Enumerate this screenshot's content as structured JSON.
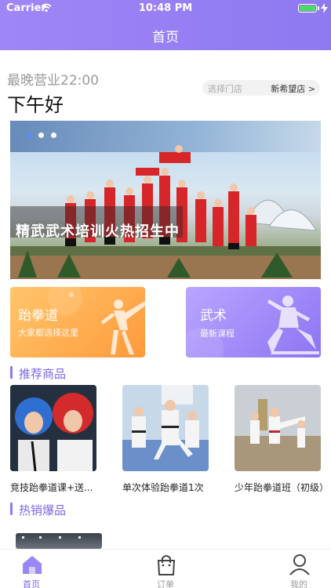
{
  "status_bar": {
    "carrier": "Carrier",
    "time": "10:48 PM"
  },
  "nav": {
    "title": "首页"
  },
  "greeting": {
    "hours": "最晚营业22:00",
    "text": "下午好"
  },
  "store": {
    "hint": "选择门店",
    "name": "新希望店 >"
  },
  "banner": {
    "caption": "精武武术培训火热招生中",
    "page_count": 3,
    "active_page": 1
  },
  "categories": [
    {
      "title": "跆拳道",
      "subtitle": "大家都选择这里"
    },
    {
      "title": "武术",
      "subtitle": "最新课程"
    }
  ],
  "sections": {
    "recommended": "推荐商品",
    "hot": "热销爆品"
  },
  "products": [
    {
      "name": "竞技跆拳道课+送..."
    },
    {
      "name": "单次体验跆拳道1次"
    },
    {
      "name": "少年跆拳道班（初级）"
    }
  ],
  "tabbar": [
    {
      "label": "首页",
      "icon": "home-icon",
      "active": true
    },
    {
      "label": "订单",
      "icon": "bag-icon",
      "active": false
    },
    {
      "label": "我的",
      "icon": "user-icon",
      "active": false
    }
  ],
  "colors": {
    "accent": "#8e79f1",
    "taekwondo_card": "#ffb04f",
    "wushu_card": "#a08cf8",
    "battery": "#4cd964"
  }
}
